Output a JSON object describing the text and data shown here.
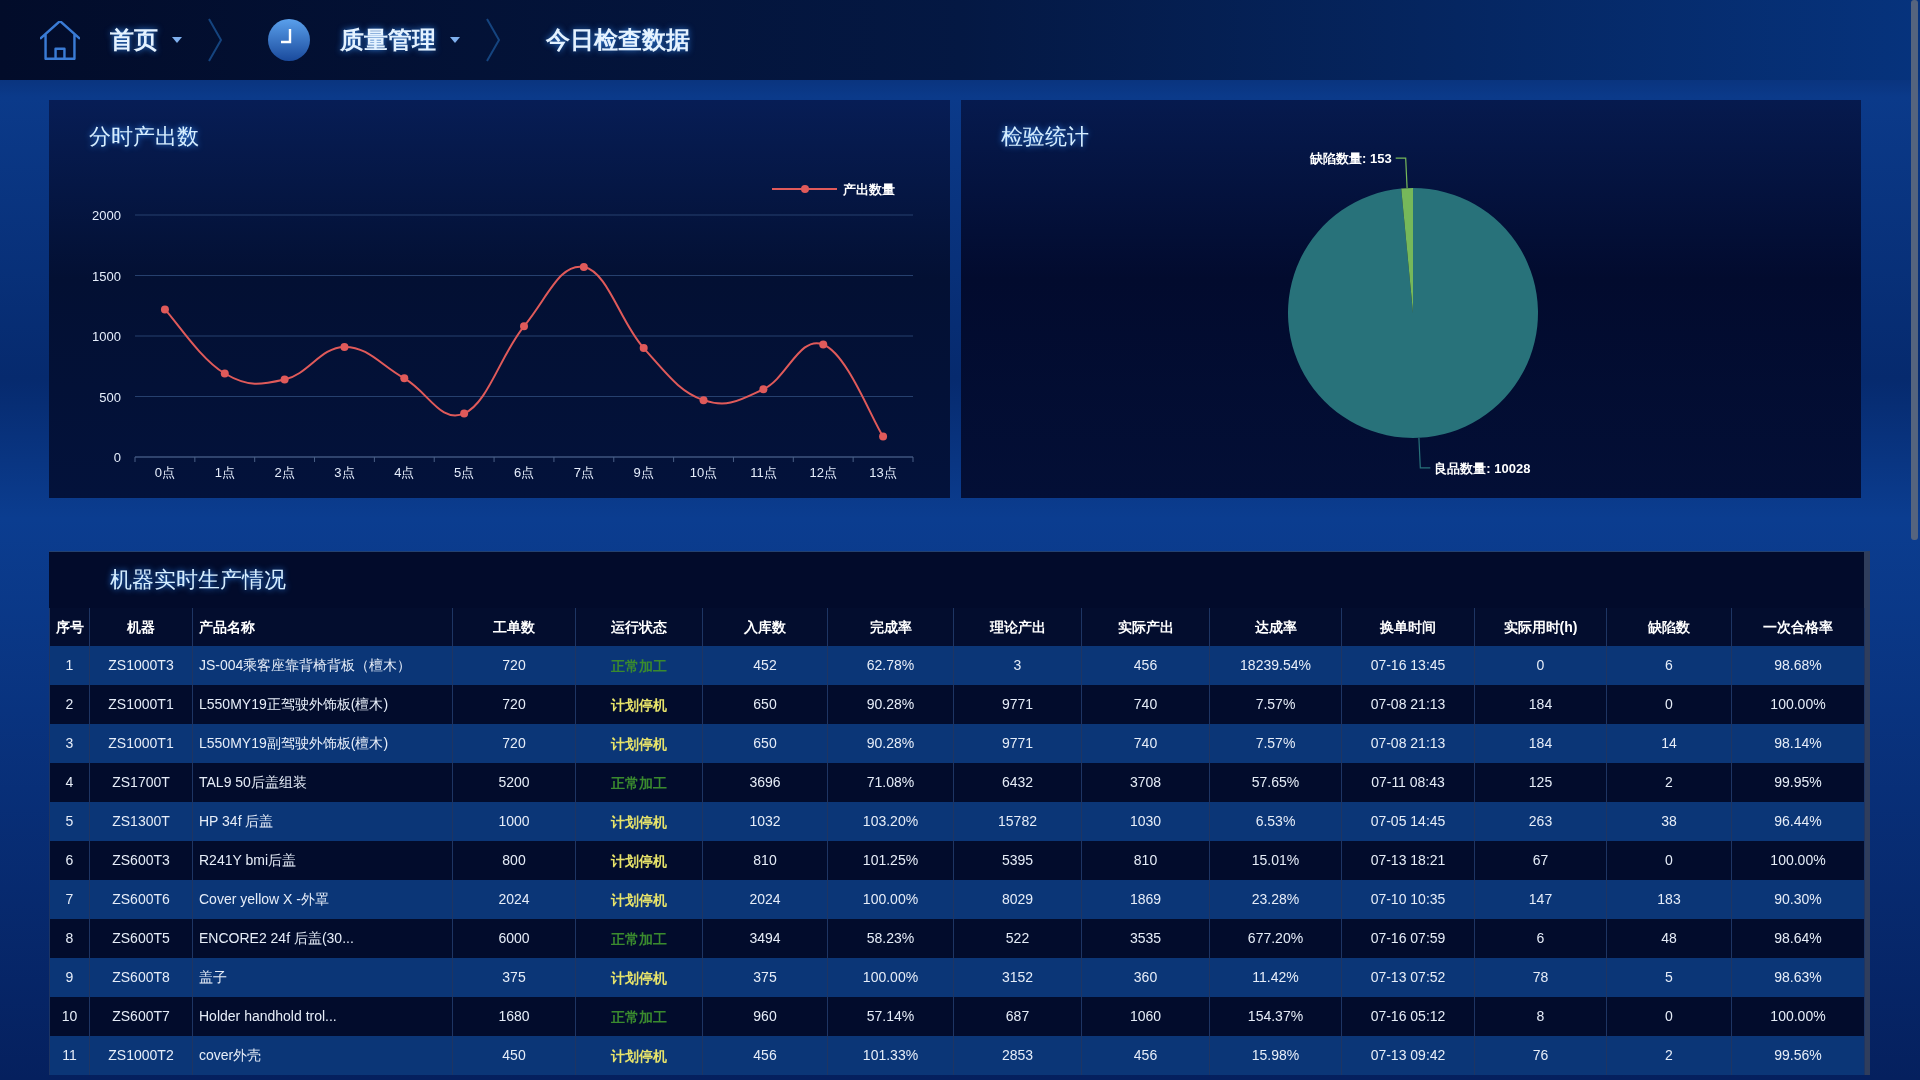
{
  "nav": {
    "items": [
      {
        "kind": "home",
        "label": "首页",
        "dropdown": true
      },
      {
        "kind": "clock",
        "label": "质量管理",
        "dropdown": true
      },
      {
        "kind": "text",
        "label": "今日检查数据",
        "dropdown": false
      }
    ]
  },
  "hourly_output": {
    "title": "分时产出数",
    "chart_data": {
      "type": "line",
      "categories": [
        "0点",
        "1点",
        "2点",
        "3点",
        "4点",
        "5点",
        "6点",
        "7点",
        "9点",
        "10点",
        "11点",
        "12点",
        "13点"
      ],
      "series": [
        {
          "name": "产出数量",
          "color": "#e05a5a",
          "marker": true,
          "values": [
            1220,
            690,
            640,
            910,
            650,
            360,
            1080,
            1570,
            900,
            470,
            560,
            930,
            170
          ]
        }
      ],
      "ylim": [
        0,
        2000
      ],
      "yticks": [
        0,
        500,
        1000,
        1500,
        2000
      ],
      "grid": true
    }
  },
  "inspection": {
    "title": "检验统计",
    "chart_data": {
      "type": "pie",
      "values": [
        10028,
        153
      ],
      "colors": [
        "#28727a",
        "#76b85a"
      ],
      "value_labels": [
        "良品数量: 10028",
        "缺陷数量: 153"
      ]
    }
  },
  "production_table": {
    "title": "机器实时生产情况",
    "columns": [
      "序号",
      "机器",
      "产品名称",
      "工单数",
      "运行状态",
      "入库数",
      "完成率",
      "理论产出",
      "实际产出",
      "达成率",
      "换单时间",
      "实际用时(h)",
      "缺陷数",
      "一次合格率"
    ],
    "rows": [
      {
        "no": "1",
        "machine": "ZS1000T3",
        "product": "JS-004乘客座靠背椅背板（檀木）",
        "orders": "720",
        "status": {
          "label": "正常加工",
          "color": "#3a8a2e"
        },
        "stocked": "452",
        "completion": "62.78%",
        "theoretical": "3",
        "actual": "456",
        "achievement": "18239.54%",
        "change_time": "07-16 13:45",
        "hours": "0",
        "defects": "6",
        "pass_rate": "98.68%"
      },
      {
        "no": "2",
        "machine": "ZS1000T1",
        "product": "L550MY19正驾驶外饰板(檀木)",
        "orders": "720",
        "status": {
          "label": "计划停机",
          "color": "#e8e46a"
        },
        "stocked": "650",
        "completion": "90.28%",
        "theoretical": "9771",
        "actual": "740",
        "achievement": "7.57%",
        "change_time": "07-08 21:13",
        "hours": "184",
        "defects": "0",
        "pass_rate": "100.00%"
      },
      {
        "no": "3",
        "machine": "ZS1000T1",
        "product": "L550MY19副驾驶外饰板(檀木)",
        "orders": "720",
        "status": {
          "label": "计划停机",
          "color": "#e8e46a"
        },
        "stocked": "650",
        "completion": "90.28%",
        "theoretical": "9771",
        "actual": "740",
        "achievement": "7.57%",
        "change_time": "07-08 21:13",
        "hours": "184",
        "defects": "14",
        "pass_rate": "98.14%"
      },
      {
        "no": "4",
        "machine": "ZS1700T",
        "product": "TAL9 50后盖组装",
        "orders": "5200",
        "status": {
          "label": "正常加工",
          "color": "#3a8a2e"
        },
        "stocked": "3696",
        "completion": "71.08%",
        "theoretical": "6432",
        "actual": "3708",
        "achievement": "57.65%",
        "change_time": "07-11 08:43",
        "hours": "125",
        "defects": "2",
        "pass_rate": "99.95%"
      },
      {
        "no": "5",
        "machine": "ZS1300T",
        "product": "HP 34f 后盖",
        "orders": "1000",
        "status": {
          "label": "计划停机",
          "color": "#e8e46a"
        },
        "stocked": "1032",
        "completion": "103.20%",
        "theoretical": "15782",
        "actual": "1030",
        "achievement": "6.53%",
        "change_time": "07-05 14:45",
        "hours": "263",
        "defects": "38",
        "pass_rate": "96.44%"
      },
      {
        "no": "6",
        "machine": "ZS600T3",
        "product": "R241Y bmi后盖",
        "orders": "800",
        "status": {
          "label": "计划停机",
          "color": "#e8e46a"
        },
        "stocked": "810",
        "completion": "101.25%",
        "theoretical": "5395",
        "actual": "810",
        "achievement": "15.01%",
        "change_time": "07-13 18:21",
        "hours": "67",
        "defects": "0",
        "pass_rate": "100.00%"
      },
      {
        "no": "7",
        "machine": "ZS600T6",
        "product": "Cover yellow X -外罩",
        "orders": "2024",
        "status": {
          "label": "计划停机",
          "color": "#e8e46a"
        },
        "stocked": "2024",
        "completion": "100.00%",
        "theoretical": "8029",
        "actual": "1869",
        "achievement": "23.28%",
        "change_time": "07-10 10:35",
        "hours": "147",
        "defects": "183",
        "pass_rate": "90.30%"
      },
      {
        "no": "8",
        "machine": "ZS600T5",
        "product": "ENCORE2 24f 后盖(30...",
        "orders": "6000",
        "status": {
          "label": "正常加工",
          "color": "#3a8a2e"
        },
        "stocked": "3494",
        "completion": "58.23%",
        "theoretical": "522",
        "actual": "3535",
        "achievement": "677.20%",
        "change_time": "07-16 07:59",
        "hours": "6",
        "defects": "48",
        "pass_rate": "98.64%"
      },
      {
        "no": "9",
        "machine": "ZS600T8",
        "product": "盖子",
        "orders": "375",
        "status": {
          "label": "计划停机",
          "color": "#e8e46a"
        },
        "stocked": "375",
        "completion": "100.00%",
        "theoretical": "3152",
        "actual": "360",
        "achievement": "11.42%",
        "change_time": "07-13 07:52",
        "hours": "78",
        "defects": "5",
        "pass_rate": "98.63%"
      },
      {
        "no": "10",
        "machine": "ZS600T7",
        "product": "Holder handhold trol...",
        "orders": "1680",
        "status": {
          "label": "正常加工",
          "color": "#3a8a2e"
        },
        "stocked": "960",
        "completion": "57.14%",
        "theoretical": "687",
        "actual": "1060",
        "achievement": "154.37%",
        "change_time": "07-16 05:12",
        "hours": "8",
        "defects": "0",
        "pass_rate": "100.00%"
      },
      {
        "no": "11",
        "machine": "ZS1000T2",
        "product": "cover外壳",
        "orders": "450",
        "status": {
          "label": "计划停机",
          "color": "#e8e46a"
        },
        "stocked": "456",
        "completion": "101.33%",
        "theoretical": "2853",
        "actual": "456",
        "achievement": "15.98%",
        "change_time": "07-13 09:42",
        "hours": "76",
        "defects": "2",
        "pass_rate": "99.56%"
      }
    ]
  }
}
